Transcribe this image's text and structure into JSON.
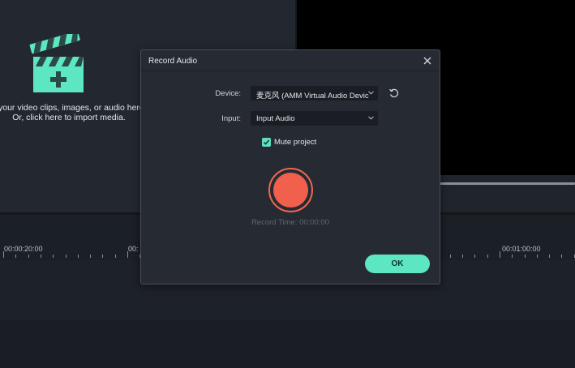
{
  "media_panel": {
    "import_line1": "your video clips, images, or audio here.",
    "import_line2": "Or, click here to import media."
  },
  "timeline": {
    "ruler_labels": [
      "00:00:20:00",
      "00:",
      "00:01:00:00"
    ]
  },
  "dialog": {
    "title": "Record Audio",
    "device_label": "Device:",
    "device_value": "麦克风 (AMM Virtual Audio Devic",
    "input_label": "Input:",
    "input_value": "Input Audio",
    "mute_label": "Mute project",
    "mute_checked": true,
    "record_time": "Record Time: 00:00:00",
    "ok_label": "OK"
  },
  "icons": {
    "clapper": "clapperboard-add-icon",
    "close": "close-icon",
    "refresh": "refresh-icon",
    "chevron": "chevron-down-icon",
    "check": "checkmark-icon",
    "record": "record-icon"
  },
  "colors": {
    "accent": "#5ce6c2",
    "record": "#f0604c",
    "dialog_bg": "#262b33",
    "app_bg": "#1b1f26"
  }
}
